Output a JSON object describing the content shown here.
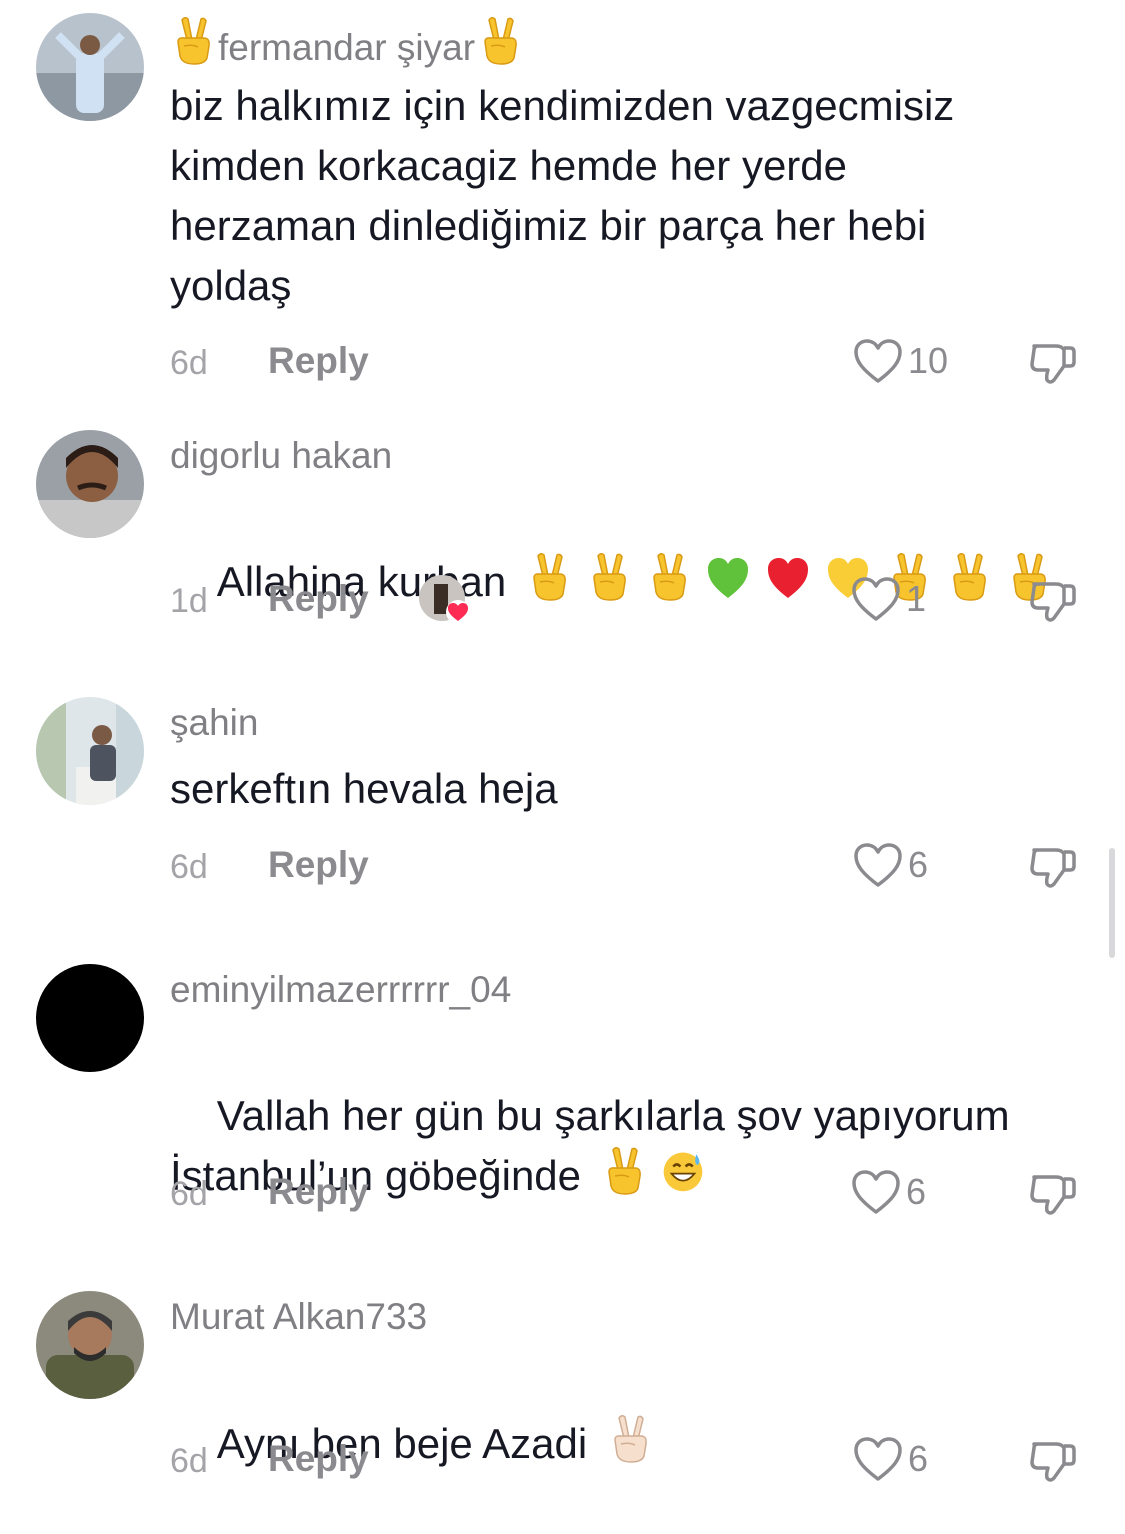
{
  "comments": [
    {
      "username": "fermandar şiyar",
      "username_emoji_before": "victory-hand",
      "username_emoji_after": "victory-hand",
      "text": "biz halkımız için kendimizden vazgecmisiz\nkimden korkacagiz hemde her yerde\nherzaman dinlediğimiz bir parça her hebi\nyoldaş",
      "time": "6d",
      "reply_label": "Reply",
      "likes": "10"
    },
    {
      "username": "digorlu hakan",
      "text": "Allahina kurban",
      "text_emojis": [
        "victory-hand",
        "victory-hand",
        "victory-hand",
        "green-heart",
        "red-heart",
        "yellow-heart",
        "victory-hand",
        "victory-hand",
        "victory-hand"
      ],
      "time": "1d",
      "reply_label": "Reply",
      "likes": "1",
      "liked_by_creator": true
    },
    {
      "username": "şahin",
      "text": "serkeftın hevala heja",
      "time": "6d",
      "reply_label": "Reply",
      "likes": "6"
    },
    {
      "username": "eminyilmazerrrrrr_04",
      "text": "Vallah her gün bu şarkılarla şov yapıyorum\nİstanbul’un göbeğinde",
      "text_emojis": [
        "victory-hand",
        "grinning-sweat-face"
      ],
      "time": "6d",
      "reply_label": "Reply",
      "likes": "6"
    },
    {
      "username": "Murat Alkan733",
      "text": "Aynı ben beje Azadi",
      "text_emojis": [
        "victory-hand-light"
      ],
      "time": "6d",
      "reply_label": "Reply",
      "likes": "6"
    }
  ],
  "colors": {
    "username": "#7f7f84",
    "body": "#161823",
    "muted": "#a3a3a8",
    "reply": "#8a8a8f",
    "victory_yellow": "#f7c42e",
    "heart_red": "#e8202f",
    "heart_green": "#5fc23a",
    "heart_yellow": "#f9cd35"
  }
}
